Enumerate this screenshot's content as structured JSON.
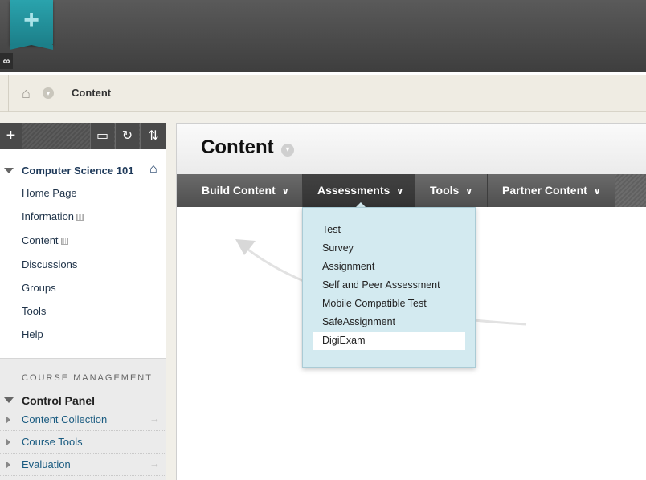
{
  "header": {
    "logo_icon": "plus-icon",
    "logo_glyph": "+",
    "link_icon": "link-icon",
    "link_glyph": "🔗"
  },
  "breadcrumb": {
    "home_icon": "home-icon",
    "current": "Content"
  },
  "sidebar": {
    "toolbar": {
      "add_glyph": "+",
      "folder_glyph": "▬",
      "refresh_glyph": "↻",
      "sort_glyph": "⇅"
    },
    "course_title": "Computer Science 101",
    "items": [
      {
        "label": "Home Page",
        "marked": false
      },
      {
        "label": "Information",
        "marked": true
      },
      {
        "label": "Content",
        "marked": true
      },
      {
        "label": "Discussions",
        "marked": false
      },
      {
        "label": "Groups",
        "marked": false
      },
      {
        "label": "Tools",
        "marked": false
      },
      {
        "label": "Help",
        "marked": false
      }
    ],
    "course_management": {
      "heading": "COURSE MANAGEMENT",
      "control_panel": "Control Panel",
      "rows": [
        {
          "label": "Content Collection",
          "arrow": true
        },
        {
          "label": "Course Tools",
          "arrow": false
        },
        {
          "label": "Evaluation",
          "arrow": true
        }
      ]
    }
  },
  "main": {
    "title": "Content",
    "menu": [
      {
        "label": "Build Content"
      },
      {
        "label": "Assessments",
        "active": true
      },
      {
        "label": "Tools"
      },
      {
        "label": "Partner Content"
      }
    ],
    "assessments_dropdown": [
      "Test",
      "Survey",
      "Assignment",
      "Self and Peer Assessment",
      "Mobile Compatible Test",
      "SafeAssignment",
      "DigiExam"
    ],
    "highlighted_item": "DigiExam"
  },
  "colors": {
    "accent_teal": "#1c7f89",
    "dropdown_bg": "#d3eaf0",
    "course_link": "#1a5b80"
  }
}
